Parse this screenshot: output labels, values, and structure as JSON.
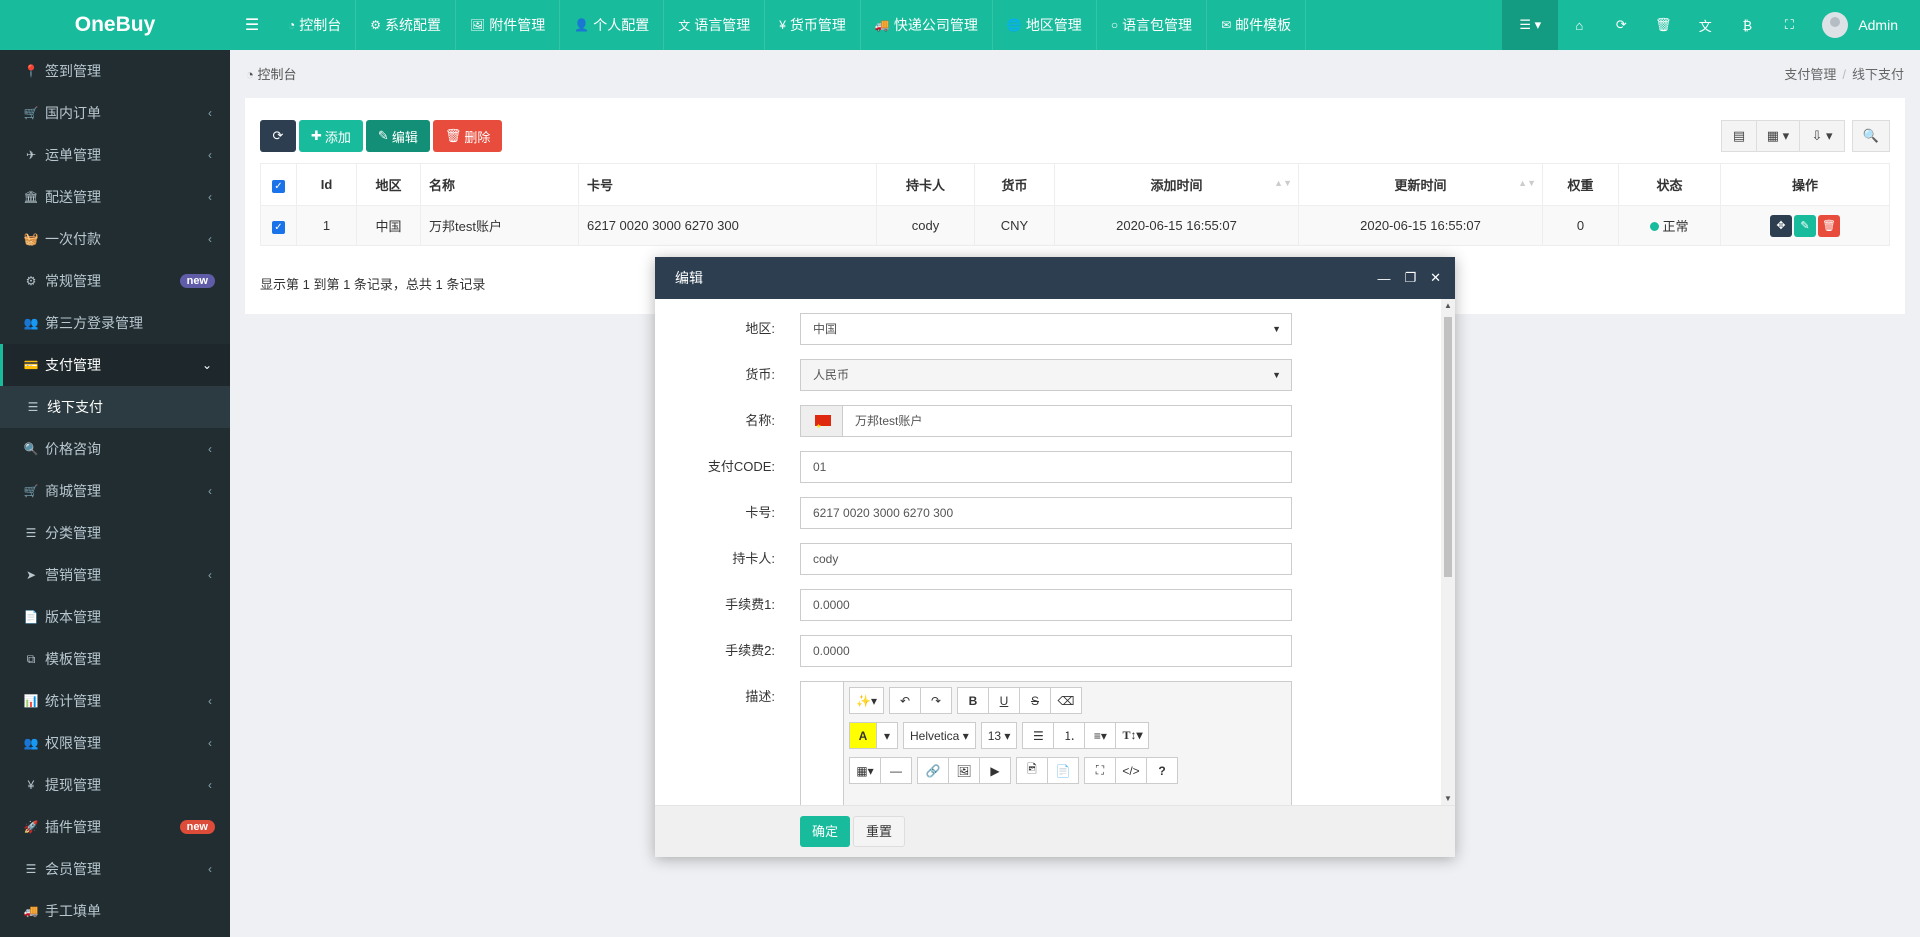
{
  "app": {
    "logo": "OneBuy"
  },
  "sidebar": {
    "items": [
      {
        "label": "签到管理",
        "icon": "map-marker-icon",
        "glyph": "📍",
        "chevron": false
      },
      {
        "label": "国内订单",
        "icon": "cart-icon",
        "glyph": "🛒",
        "chevron": true
      },
      {
        "label": "运单管理",
        "icon": "plane-icon",
        "glyph": "✈",
        "chevron": true
      },
      {
        "label": "配送管理",
        "icon": "bank-icon",
        "glyph": "🏛",
        "chevron": true
      },
      {
        "label": "一次付款",
        "icon": "basket-icon",
        "glyph": "🧺",
        "chevron": true
      },
      {
        "label": "常规管理",
        "icon": "cogs-icon",
        "glyph": "⚙",
        "badge": "new",
        "badge_color": "#605ca8"
      },
      {
        "label": "第三方登录管理",
        "icon": "users-icon",
        "glyph": "👥",
        "chevron": false
      },
      {
        "label": "支付管理",
        "icon": "credit-card-icon",
        "glyph": "💳",
        "active": true,
        "chevron_down": true
      },
      {
        "label": "线下支付",
        "icon": "list-icon",
        "glyph": "☰",
        "sub": true
      },
      {
        "label": "价格咨询",
        "icon": "search-icon",
        "glyph": "🔍",
        "chevron": true
      },
      {
        "label": "商城管理",
        "icon": "cart-icon",
        "glyph": "🛒",
        "chevron": true
      },
      {
        "label": "分类管理",
        "icon": "list-icon",
        "glyph": "☰",
        "chevron": false
      },
      {
        "label": "营销管理",
        "icon": "paper-plane-icon",
        "glyph": "➤",
        "chevron": true
      },
      {
        "label": "版本管理",
        "icon": "file-icon",
        "glyph": "📄",
        "chevron": false
      },
      {
        "label": "模板管理",
        "icon": "clone-icon",
        "glyph": "⧉",
        "chevron": false
      },
      {
        "label": "统计管理",
        "icon": "bar-chart-icon",
        "glyph": "📊",
        "chevron": true
      },
      {
        "label": "权限管理",
        "icon": "group-icon",
        "glyph": "👥",
        "chevron": true
      },
      {
        "label": "提现管理",
        "icon": "yen-icon",
        "glyph": "¥",
        "chevron": true
      },
      {
        "label": "插件管理",
        "icon": "rocket-icon",
        "glyph": "🚀",
        "badge": "new",
        "badge_color": "#dd4b39"
      },
      {
        "label": "会员管理",
        "icon": "list-icon",
        "glyph": "☰",
        "chevron": true
      },
      {
        "label": "手工填单",
        "icon": "truck-icon",
        "glyph": "🚚",
        "chevron": false
      }
    ]
  },
  "topnav": {
    "items": [
      {
        "label": "控制台",
        "icon": "dashboard-icon",
        "glyph": "◔"
      },
      {
        "label": "系统配置",
        "icon": "cog-icon",
        "glyph": "⚙"
      },
      {
        "label": "附件管理",
        "icon": "file-image-icon",
        "glyph": "🖼"
      },
      {
        "label": "个人配置",
        "icon": "user-icon",
        "glyph": "👤"
      },
      {
        "label": "语言管理",
        "icon": "language-icon",
        "glyph": "文"
      },
      {
        "label": "货币管理",
        "icon": "yen-icon",
        "glyph": "¥"
      },
      {
        "label": "快递公司管理",
        "icon": "truck-icon",
        "glyph": "🚚"
      },
      {
        "label": "地区管理",
        "icon": "globe-icon",
        "glyph": "🌐"
      },
      {
        "label": "语言包管理",
        "icon": "circle-icon",
        "glyph": "○"
      },
      {
        "label": "邮件模板",
        "icon": "envelope-icon",
        "glyph": "✉"
      }
    ],
    "user": "Admin"
  },
  "breadcrumb": {
    "left": "控制台",
    "right": [
      "支付管理",
      "线下支付"
    ]
  },
  "toolbar": {
    "add": "添加",
    "edit": "编辑",
    "delete": "删除"
  },
  "table": {
    "headers": [
      "Id",
      "地区",
      "名称",
      "卡号",
      "持卡人",
      "货币",
      "添加时间",
      "更新时间",
      "权重",
      "状态",
      "操作"
    ],
    "rows": [
      {
        "id": "1",
        "region": "中国",
        "name": "万邦test账户",
        "card": "6217 0020 3000 6270 300",
        "holder": "cody",
        "currency": "CNY",
        "created": "2020-06-15 16:55:07",
        "updated": "2020-06-15 16:55:07",
        "weight": "0",
        "status": "正常"
      }
    ],
    "summary": "显示第 1 到第 1 条记录，总共 1 条记录"
  },
  "modal": {
    "title": "编辑",
    "fields": {
      "region_label": "地区:",
      "region_value": "中国",
      "currency_label": "货币:",
      "currency_value": "人民币",
      "name_label": "名称:",
      "name_value": "万邦test账户",
      "code_label": "支付CODE:",
      "code_value": "01",
      "card_label": "卡号:",
      "card_value": "6217 0020 3000 6270 300",
      "holder_label": "持卡人:",
      "holder_value": "cody",
      "fee1_label": "手续费1:",
      "fee1_value": "0.0000",
      "fee2_label": "手续费2:",
      "fee2_value": "0.0000",
      "desc_label": "描述:"
    },
    "editor": {
      "font": "Helvetica",
      "size": "13"
    },
    "ok": "确定",
    "reset": "重置"
  },
  "colors": {
    "primary": "#18bc9c",
    "sidebar": "#222d32",
    "dark": "#2c3e50",
    "danger": "#e74c3c"
  }
}
